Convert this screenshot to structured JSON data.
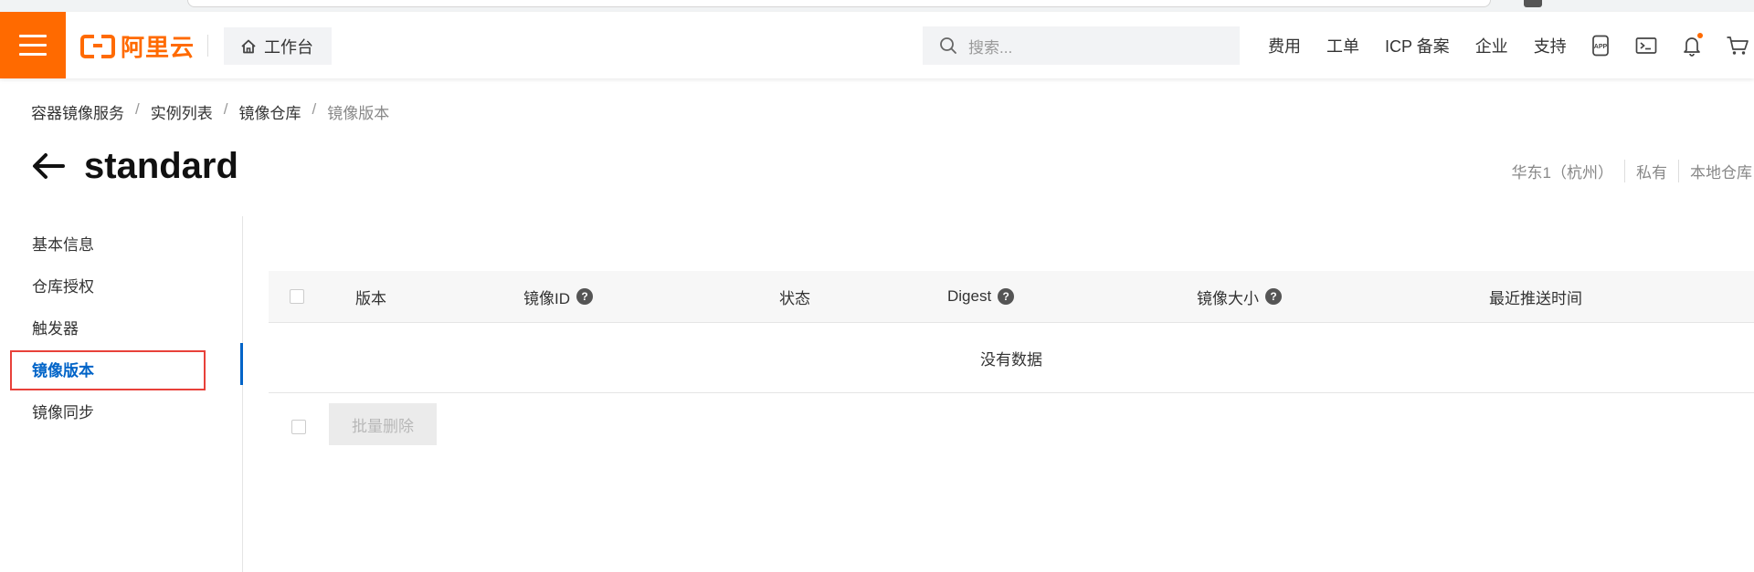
{
  "header": {
    "logo_text": "阿里云",
    "workbench_label": "工作台",
    "search_placeholder": "搜索...",
    "nav_links": [
      "费用",
      "工单",
      "ICP 备案",
      "企业",
      "支持"
    ],
    "brand_color": "#ff6a00",
    "notification_dot": true
  },
  "breadcrumb": [
    "容器镜像服务",
    "实例列表",
    "镜像仓库",
    "镜像版本"
  ],
  "page": {
    "title": "standard",
    "meta": [
      "华东1（杭州）",
      "私有",
      "本地仓库"
    ]
  },
  "sidebar": {
    "items": [
      "基本信息",
      "仓库授权",
      "触发器",
      "镜像版本",
      "镜像同步"
    ],
    "active_index": 3,
    "accent_color": "#0064c8"
  },
  "table": {
    "columns": [
      "版本",
      "镜像ID",
      "状态",
      "Digest",
      "镜像大小",
      "最近推送时间"
    ],
    "columns_with_help": [
      "镜像ID",
      "Digest",
      "镜像大小"
    ],
    "empty_text": "没有数据",
    "rows": []
  },
  "actions": {
    "batch_delete_label": "批量删除",
    "batch_delete_disabled": true
  },
  "icons": {
    "menu": "hamburger-icon",
    "home": "home-icon",
    "search": "search-icon",
    "app": "app-icon",
    "terminal": "terminal-icon",
    "bell": "bell-icon",
    "cart": "cart-icon",
    "back": "back-arrow-icon",
    "help": "question-circle-icon"
  }
}
